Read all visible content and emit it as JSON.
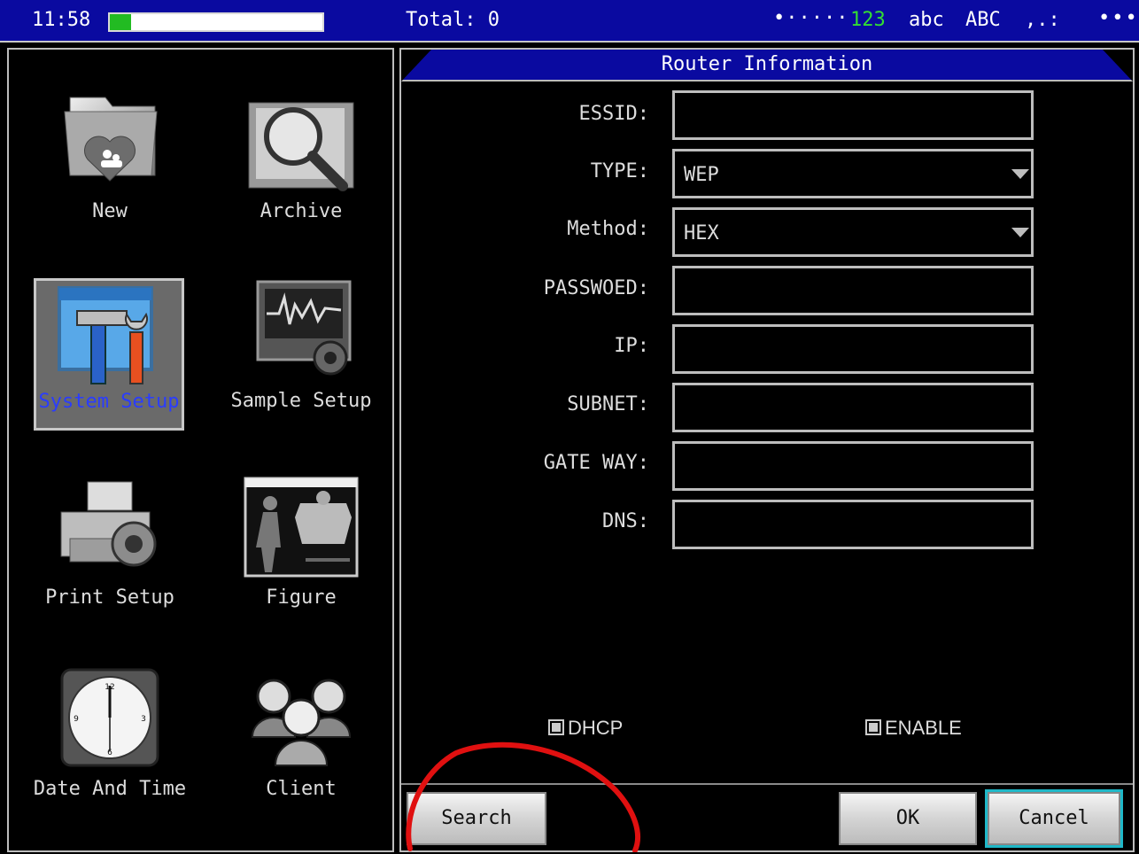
{
  "status_bar": {
    "time": "11:58",
    "progress_fraction": 0.1,
    "total": "Total: 0",
    "signal": "•·····",
    "mode_123": "123",
    "mode_abc": "abc",
    "mode_ABC": "ABC",
    "mode_punct": ",.:",
    "more": "•••",
    "accent_color": "#0a0aa0"
  },
  "menu": {
    "items": [
      {
        "label": "New",
        "icon": "folder-heart-icon"
      },
      {
        "label": "Archive",
        "icon": "magnifier-icon"
      },
      {
        "label": "System Setup",
        "icon": "tools-icon",
        "selected": true
      },
      {
        "label": "Sample Setup",
        "icon": "monitor-gear-icon"
      },
      {
        "label": "Print Setup",
        "icon": "printer-gear-icon"
      },
      {
        "label": "Figure",
        "icon": "body-figure-icon"
      },
      {
        "label": "Date And Time",
        "icon": "clock-icon"
      },
      {
        "label": "Client",
        "icon": "users-icon"
      }
    ]
  },
  "dialog": {
    "title": "Router Information",
    "fields": [
      {
        "label": "ESSID:",
        "value": ""
      },
      {
        "label": "TYPE:",
        "value": "WEP",
        "dropdown": true
      },
      {
        "label": "Method:",
        "value": "HEX",
        "dropdown": true
      },
      {
        "label": "PASSWOED:",
        "value": ""
      },
      {
        "label": "IP:",
        "value": ""
      },
      {
        "label": "SUBNET:",
        "value": ""
      },
      {
        "label": "GATE WAY:",
        "value": ""
      },
      {
        "label": "DNS:",
        "value": ""
      }
    ],
    "dhcp_label": "DHCP",
    "enable_label": "ENABLE",
    "search_label": "Search",
    "ok_label": "OK",
    "cancel_label": "Cancel"
  }
}
